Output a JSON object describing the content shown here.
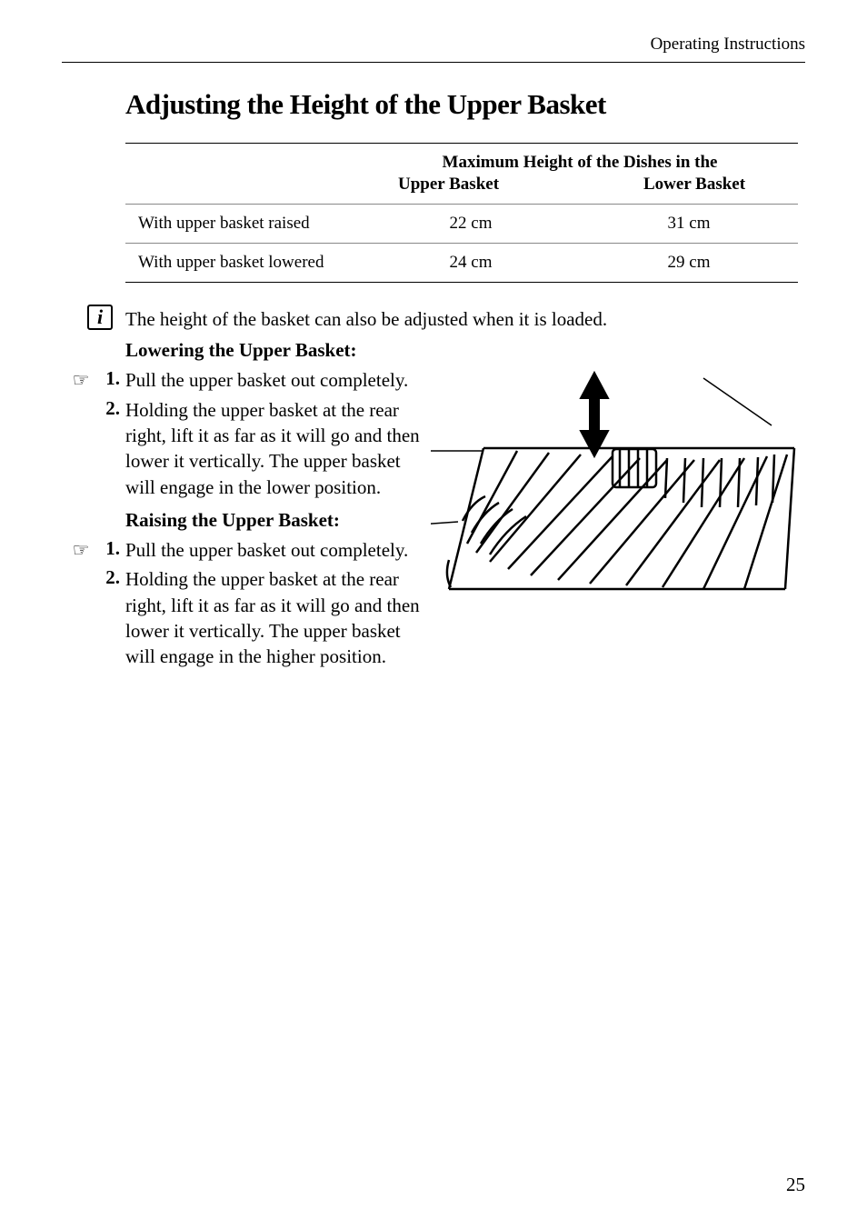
{
  "header": {
    "section_title": "Operating Instructions"
  },
  "heading": "Adjusting the Height of the Upper Basket",
  "table": {
    "super_header": "Maximum Height of the Dishes in the",
    "col_upper": "Upper Basket",
    "col_lower": "Lower Basket",
    "rows": [
      {
        "label": "With upper basket raised",
        "upper": "22 cm",
        "lower": "31 cm"
      },
      {
        "label": "With upper basket lowered",
        "upper": "24 cm",
        "lower": "29 cm"
      }
    ]
  },
  "info_note": "The height of the basket can also be adjusted when it is loaded.",
  "lowering": {
    "heading": "Lowering the Upper Basket:",
    "steps": [
      {
        "num": "1.",
        "text": "Pull the upper basket out completely."
      },
      {
        "num": "2.",
        "text": "Holding the upper basket at the rear right, lift it as far as it will go and then lower it vertically. The upper basket will engage in the lower posi­tion."
      }
    ]
  },
  "raising": {
    "heading": "Raising the Upper Basket:",
    "steps": [
      {
        "num": "1.",
        "text": "Pull the upper basket out completely."
      },
      {
        "num": "2.",
        "text": "Holding the upper basket at the rear right, lift it as far as it will go and then lower it vertically. The upper basket will engage in the higher posi­tion."
      }
    ]
  },
  "page_number": "25",
  "icons": {
    "info": "i",
    "hand": "☞"
  }
}
